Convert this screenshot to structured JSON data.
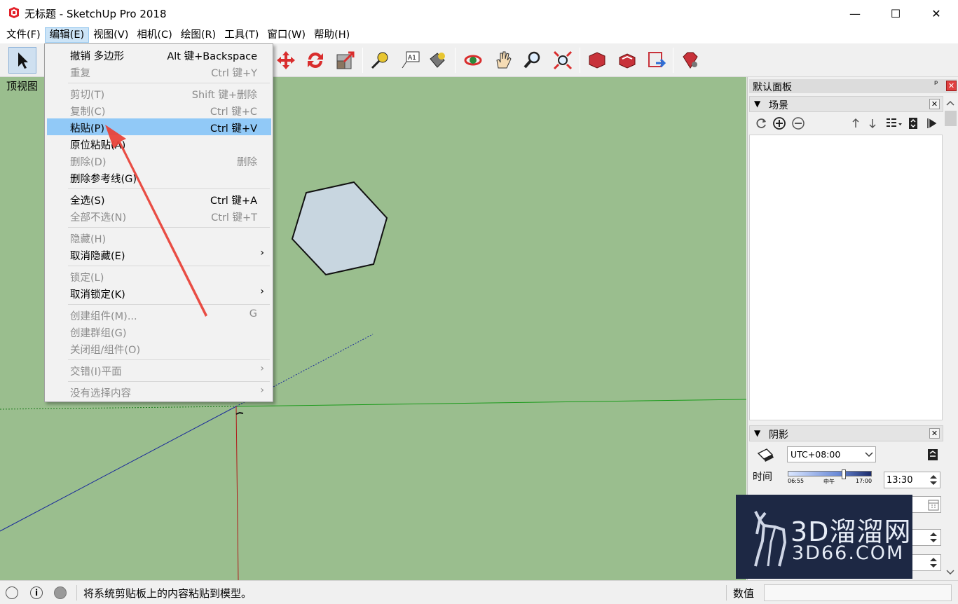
{
  "window": {
    "title": "无标题 - SketchUp Pro 2018",
    "min_icon": "minimize-icon",
    "max_icon": "maximize-icon",
    "close_icon": "close-icon",
    "min_glyph": "—",
    "max_glyph": "☐",
    "close_glyph": "✕"
  },
  "menubar": [
    "文件(F)",
    "编辑(E)",
    "视图(V)",
    "相机(C)",
    "绘图(R)",
    "工具(T)",
    "窗口(W)",
    "帮助(H)"
  ],
  "viewport": {
    "label": "顶视图",
    "bg_color": "#9abe8e",
    "face_color": "#c8d6e0"
  },
  "edit_menu": {
    "items": [
      {
        "label": "撤销 多边形",
        "shortcut": "Alt 键+Backspace",
        "disabled": false
      },
      {
        "label": "重复",
        "shortcut": "Ctrl 键+Y",
        "disabled": true
      },
      {
        "label": "剪切(T)",
        "shortcut": "Shift 键+删除",
        "disabled": true
      },
      {
        "label": "复制(C)",
        "shortcut": "Ctrl 键+C",
        "disabled": true
      },
      {
        "label": "粘贴(P)",
        "shortcut": "Ctrl 键+V",
        "disabled": false,
        "highlighted": true
      },
      {
        "label": "原位粘贴(A)",
        "shortcut": "",
        "disabled": false
      },
      {
        "label": "删除(D)",
        "shortcut": "删除",
        "disabled": true
      },
      {
        "label": "删除参考线(G)",
        "shortcut": "",
        "disabled": false
      },
      {
        "label": "全选(S)",
        "shortcut": "Ctrl 键+A",
        "disabled": false
      },
      {
        "label": "全部不选(N)",
        "shortcut": "Ctrl 键+T",
        "disabled": true
      },
      {
        "label": "隐藏(H)",
        "shortcut": "",
        "disabled": true
      },
      {
        "label": "取消隐藏(E)",
        "shortcut": "",
        "disabled": false,
        "submenu": true
      },
      {
        "label": "锁定(L)",
        "shortcut": "",
        "disabled": true
      },
      {
        "label": "取消锁定(K)",
        "shortcut": "",
        "disabled": false,
        "submenu": true
      },
      {
        "label": "创建组件(M)...",
        "shortcut": "G",
        "disabled": true
      },
      {
        "label": "创建群组(G)",
        "shortcut": "",
        "disabled": true
      },
      {
        "label": "关闭组/组件(O)",
        "shortcut": "",
        "disabled": true
      },
      {
        "label": "交错(I)平面",
        "shortcut": "",
        "disabled": true,
        "submenu": true
      },
      {
        "label": "没有选择内容",
        "shortcut": "",
        "disabled": true,
        "submenu": true
      }
    ],
    "submenu_glyph": "›"
  },
  "tray": {
    "title": "默认面板",
    "pin_glyph": "ᵖ",
    "close_glyph": "✕",
    "scenes_panel": {
      "title": "场景",
      "collapse_glyph": "▼"
    },
    "shadow_panel": {
      "title": "阴影",
      "timezone": "UTC+08:00",
      "time_label": "时间",
      "time_value": "13:30",
      "slider_start": "06:55",
      "slider_mid": "中午",
      "slider_end": "17:00"
    }
  },
  "watermark": {
    "big": "3D溜溜网",
    "small": "3D66.COM"
  },
  "statusbar": {
    "message": "将系统剪贴板上的内容粘贴到模型。",
    "measure_label": "数值"
  }
}
